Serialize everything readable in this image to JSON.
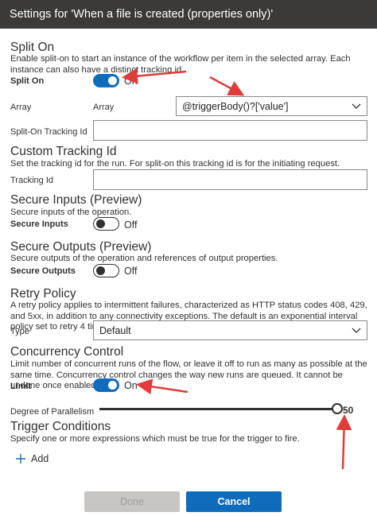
{
  "window": {
    "title": "Settings for 'When a file is created (properties only)'"
  },
  "split_on": {
    "heading": "Split On",
    "description": "Enable split-on to start an instance of the workflow per item in the selected array. Each instance can also have a distinct tracking id.",
    "toggle_label": "Split On",
    "toggle_state": "On",
    "array_label": "Array",
    "array_inner_label": "Array",
    "array_value": "@triggerBody()?['value']",
    "tracking_label": "Split-On Tracking Id",
    "tracking_value": ""
  },
  "custom_tracking": {
    "heading": "Custom Tracking Id",
    "description": "Set the tracking id for the run. For split-on this tracking id is for the initiating request.",
    "field_label": "Tracking Id",
    "field_value": ""
  },
  "secure_inputs": {
    "heading": "Secure Inputs (Preview)",
    "description": "Secure inputs of the operation.",
    "toggle_label": "Secure Inputs",
    "toggle_state": "Off"
  },
  "secure_outputs": {
    "heading": "Secure Outputs (Preview)",
    "description": "Secure outputs of the operation and references of output properties.",
    "toggle_label": "Secure Outputs",
    "toggle_state": "Off"
  },
  "retry": {
    "heading": "Retry Policy",
    "description": "A retry policy applies to intermittent failures, characterized as HTTP status codes 408, 429, and 5xx, in addition to any connectivity exceptions. The default is an exponential interval policy set to retry 4 times.",
    "type_label": "Type",
    "type_value": "Default"
  },
  "concurrency": {
    "heading": "Concurrency Control",
    "description": "Limit number of concurrent runs of the flow, or leave it off to run as many as possible at the same time. Concurrency control changes the way new runs are queued. It cannot be undone once enabled.",
    "toggle_label": "Limit",
    "toggle_state": "On",
    "parallelism_label": "Degree of Parallelism",
    "parallelism_value": "50",
    "parallelism_fraction": 1.0
  },
  "trigger_conditions": {
    "heading": "Trigger Conditions",
    "description": "Specify one or more expressions which must be true for the trigger to fire.",
    "add_label": "Add"
  },
  "footer": {
    "done_label": "Done",
    "cancel_label": "Cancel"
  },
  "colors": {
    "accent": "#0f6cbd",
    "annotation_arrow": "#e03c3c",
    "titlebar": "#3b3a39"
  },
  "icons": {
    "add": "plus-icon",
    "dropdown": "chevron-down-icon"
  }
}
